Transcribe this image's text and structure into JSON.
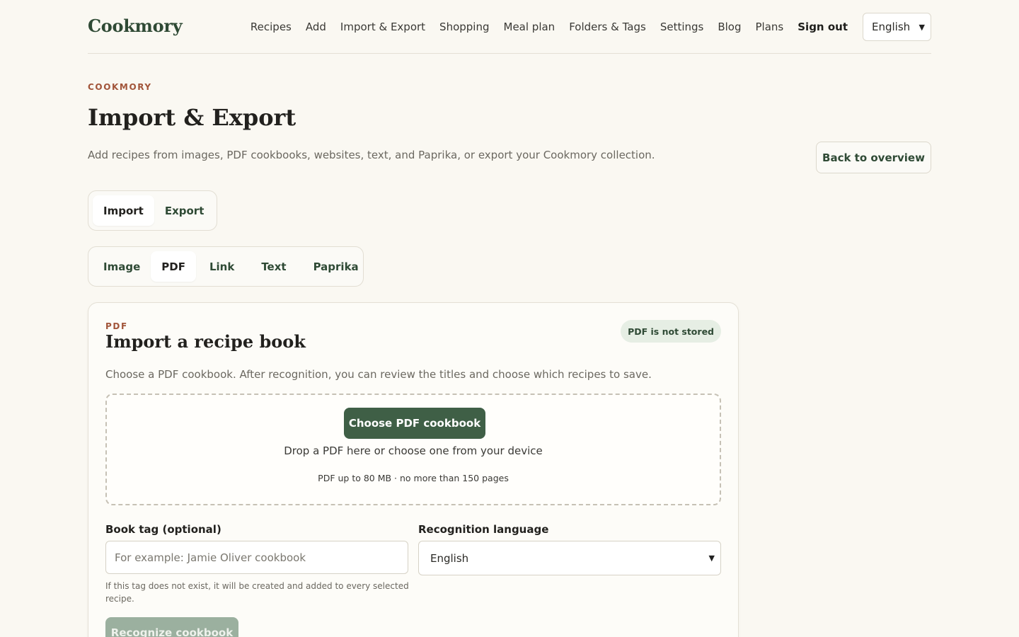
{
  "brand": "Cookmory",
  "nav": {
    "items": [
      "Recipes",
      "Add",
      "Import & Export",
      "Shopping",
      "Meal plan",
      "Folders & Tags",
      "Settings",
      "Blog",
      "Plans"
    ],
    "sign_out": "Sign out",
    "language": "English"
  },
  "page": {
    "eyebrow": "COOKMORY",
    "title": "Import & Export",
    "subtitle": "Add recipes from images, PDF cookbooks, websites, text, and Paprika, or export your Cookmory collection.",
    "back_label": "Back to overview"
  },
  "mode_tabs": [
    {
      "label": "Import",
      "active": true
    },
    {
      "label": "Export",
      "active": false
    }
  ],
  "source_tabs": [
    {
      "label": "Image",
      "active": false
    },
    {
      "label": "PDF",
      "active": true
    },
    {
      "label": "Link",
      "active": false
    },
    {
      "label": "Text",
      "active": false
    },
    {
      "label": "Paprika",
      "active": false
    }
  ],
  "card": {
    "eyebrow": "PDF",
    "title": "Import a recipe book",
    "badge": "PDF is not stored",
    "description": "Choose a PDF cookbook. After recognition, you can review the titles and choose which recipes to save.",
    "drop": {
      "button": "Choose PDF cookbook",
      "text": "Drop a PDF here or choose one from your device",
      "hint": "PDF up to 80 MB · no more than 150 pages"
    },
    "book_tag": {
      "label": "Book tag (optional)",
      "placeholder": "For example: Jamie Oliver cookbook",
      "value": "",
      "help": "If this tag does not exist, it will be created and added to every selected recipe."
    },
    "recognition_language": {
      "label": "Recognition language",
      "value": "English"
    },
    "recognize_button": "Recognize cookbook"
  },
  "colors": {
    "background": "#faf8f2",
    "brand_green": "#2f4a35",
    "primary_button": "#3f5f46",
    "disabled_button": "#9bb09f",
    "eyebrow": "#a2553a",
    "badge_bg": "#e6eee4"
  }
}
